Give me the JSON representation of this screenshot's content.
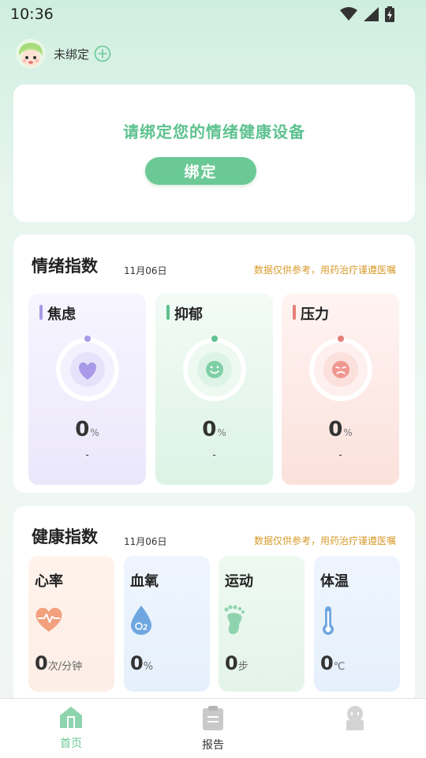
{
  "status_bar": {
    "time": "10:36"
  },
  "header": {
    "bind_status": "未绑定"
  },
  "bind_card": {
    "prompt": "请绑定您的情绪健康设备",
    "button_label": "绑定"
  },
  "emotion": {
    "title": "情绪指数",
    "date": "11月06日",
    "note": "数据仅供参考，用药治疗谨遵医嘱",
    "items": [
      {
        "label": "焦虑",
        "value": "0",
        "unit": "%",
        "sub": "-",
        "color": "#a99ae8"
      },
      {
        "label": "抑郁",
        "value": "0",
        "unit": "%",
        "sub": "-",
        "color": "#5ec28f"
      },
      {
        "label": "压力",
        "value": "0",
        "unit": "%",
        "sub": "-",
        "color": "#e5807a"
      }
    ]
  },
  "health": {
    "title": "健康指数",
    "date": "11月06日",
    "note": "数据仅供参考，用药治疗谨遵医嘱",
    "items": [
      {
        "label": "心率",
        "value": "0",
        "unit": "次/分钟",
        "icon": "heart-rate-icon",
        "color": "#f2a07e"
      },
      {
        "label": "血氧",
        "value": "0",
        "unit": "%",
        "icon": "blood-oxygen-icon",
        "color": "#6ea6e0"
      },
      {
        "label": "运动",
        "value": "0",
        "unit": "步",
        "icon": "footprint-icon",
        "color": "#8fd3ae"
      },
      {
        "label": "体温",
        "value": "0",
        "unit": "℃",
        "icon": "thermometer-icon",
        "color": "#6ea6e0"
      }
    ]
  },
  "tabbar": {
    "tabs": [
      {
        "label": "首页",
        "active": true
      },
      {
        "label": "报告",
        "active": false
      },
      {
        "label": "",
        "active": false
      }
    ],
    "active_color": "#6bc996",
    "inactive_color": "#777777"
  }
}
